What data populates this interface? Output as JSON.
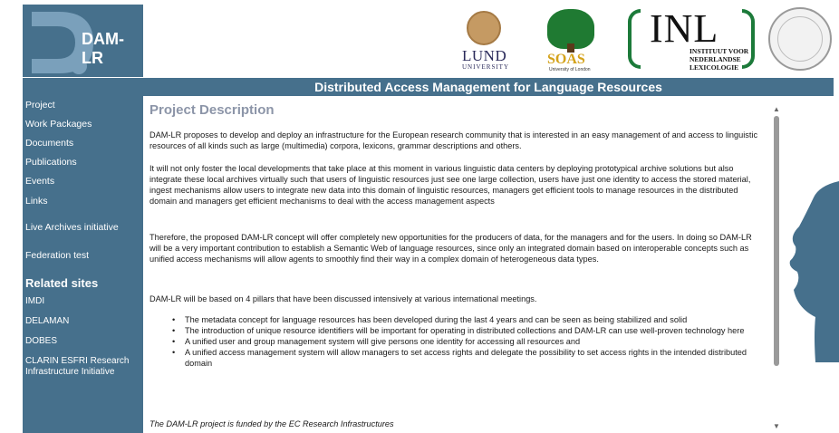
{
  "logo": {
    "text": "DAM-LR"
  },
  "partners": {
    "lund_name": "LUND",
    "lund_sub": "UNIVERSITY",
    "soas_name": "SOAS",
    "soas_sub": "University of London",
    "inl_name": "INL",
    "inl_lines": [
      "INSTITUUT VOOR",
      "NEDERLANDSE",
      "LEXICOLOGIE"
    ]
  },
  "title_bar": "Distributed Access Management for Language Resources",
  "sidebar": {
    "items": [
      "Project",
      "Work Packages",
      "Documents",
      "Publications",
      "Events",
      "Links"
    ],
    "extra_items": [
      "Live Archives initiative",
      "Federation test"
    ],
    "related_heading": "Related sites",
    "related_items": [
      "IMDI",
      "DELAMAN",
      "DOBES",
      "CLARIN ESFRI Research Infrastructure Initiative"
    ]
  },
  "main": {
    "heading": "Project Description",
    "paragraphs": [
      "DAM-LR proposes to develop and deploy an infrastructure for the European research community that is interested in an easy management of and access to linguistic resources of all kinds such as large (multimedia) corpora, lexicons, grammar descriptions and others.",
      "It will not only foster the local developments that take place at this moment in various linguistic data centers by deploying prototypical archive solutions but also integrate these local archives virtually such that users of linguistic resources just see one large collection, users have just one identity to access the stored material, ingest mechanisms allow users to integrate new data into this domain of linguistic resources, managers get efficient tools to manage resources in the distributed domain and managers get efficient mechanisms to deal with the access management aspects",
      "Therefore, the proposed DAM-LR concept will offer completely new opportunities for the producers of data, for the managers and for the users. In doing so DAM-LR will be a very important contribution to establish a Semantic Web of language resources, since only an integrated domain based on interoperable concepts such as unified access mechanisms will allow agents to smoothly find their way in a complex domain of heterogeneous data types.",
      "DAM-LR will be based on 4 pillars that have been discussed intensively at various international meetings."
    ],
    "bullets": [
      "The metadata concept for language resources has been developed during the last 4 years and can be seen as being stabilized and solid",
      "The introduction of unique resource identifiers will be important for operating in distributed collections and DAM-LR can use well-proven technology here",
      "A unified user and group management system will give persons one identity for accessing all resources and",
      "A unified access management system will allow managers to set access rights and delegate the possibility to set access rights in the intended distributed domain"
    ],
    "footer_note": "The DAM-LR project is funded by the EC Research Infrastructures"
  },
  "colors": {
    "brand": "#46708c",
    "heading": "#8c95a8"
  },
  "icons": {
    "scroll_up": "▲",
    "scroll_down": "▼"
  }
}
